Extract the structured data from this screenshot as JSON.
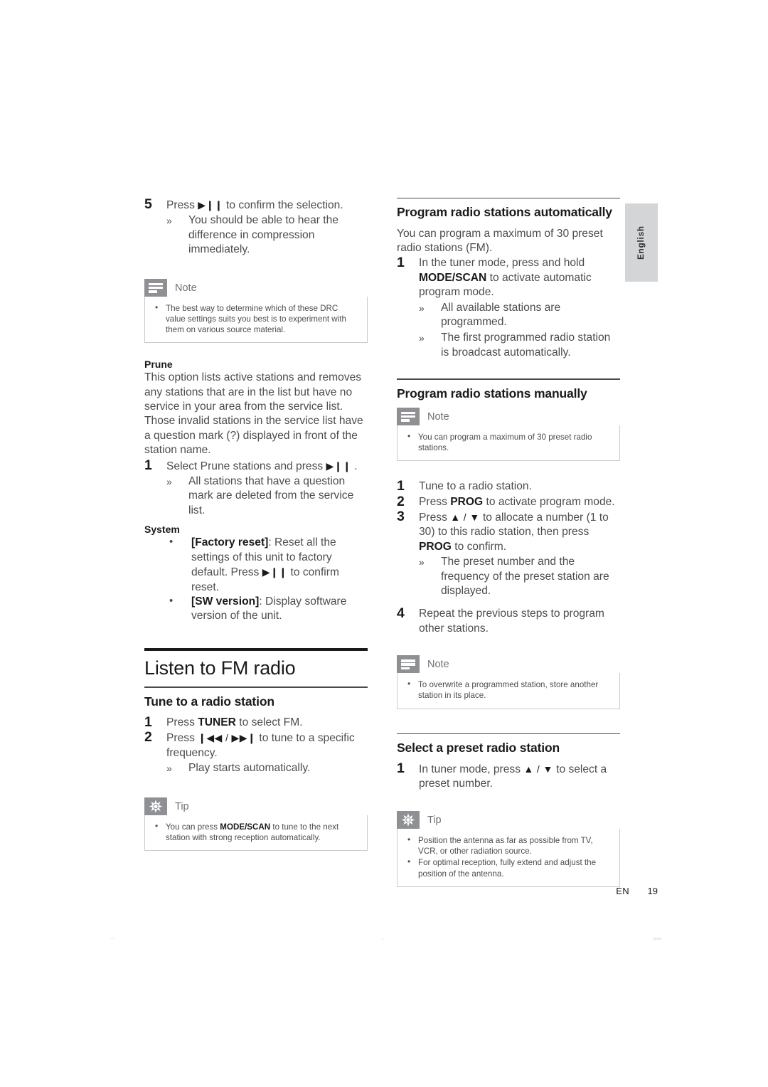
{
  "page": {
    "language_tab": "English",
    "footer_language_code": "EN",
    "footer_page_number": "19"
  },
  "left_column": {
    "step5": {
      "number": "5",
      "text_before": "Press",
      "glyph": "▶❙❙",
      "text_after": "to confirm the selection.",
      "result": "You should be able to hear the difference in compression immediately."
    },
    "note_drc": {
      "label": "Note",
      "icon": "note-icon",
      "items": [
        "The best way to determine which of these DRC value settings suits you best is to experiment with them on various source material."
      ]
    },
    "prune": {
      "heading": "Prune",
      "paragraph": "This option lists active stations and removes any stations that are in the list but have no service in your area from the service list. Those invalid stations in the service list have a question mark (?) displayed in front of the station name.",
      "step1": {
        "number": "1",
        "text_before": "Select Prune stations and press",
        "glyph": "▶❙❙",
        "text_after": ".",
        "result": "All stations that have a question mark are deleted from the service list."
      }
    },
    "system": {
      "heading": "System",
      "items": [
        {
          "term": "[Factory reset]",
          "text_before": ": Reset all the settings of this unit to factory default. Press",
          "glyph": "▶❙❙",
          "text_after": "to confirm reset."
        },
        {
          "term": "[SW version]",
          "text_before": ": Display software version of the unit.",
          "glyph": "",
          "text_after": ""
        }
      ]
    },
    "listen_fm": {
      "title": "Listen to FM radio",
      "tune": {
        "heading": "Tune to a radio station",
        "step1": {
          "number": "1",
          "text_before": "Press",
          "kbd": "TUNER",
          "text_after": "to select FM."
        },
        "step2": {
          "number": "2",
          "text_before": "Press",
          "glyph": "❙◀◀ / ▶▶❙",
          "text_after": "to tune to a specific frequency.",
          "result": "Play starts automatically."
        }
      },
      "tip": {
        "label": "Tip",
        "icon": "tip-icon",
        "items": [
          {
            "before": "You can press ",
            "kbd": "MODE/SCAN",
            "after": " to tune to the next station with strong reception automatically."
          }
        ]
      }
    }
  },
  "right_column": {
    "program_auto": {
      "heading": "Program radio stations automatically",
      "paragraph": "You can program a maximum of 30 preset radio stations (FM).",
      "step1": {
        "number": "1",
        "text_before": "In the tuner mode, press and hold",
        "kbd": "MODE/SCAN",
        "text_after": "to activate automatic program mode.",
        "results": [
          "All available stations are programmed.",
          "The first programmed radio station is broadcast automatically."
        ]
      }
    },
    "program_manual": {
      "heading": "Program radio stations manually",
      "note": {
        "label": "Note",
        "icon": "note-icon",
        "items": [
          "You can program a maximum of 30 preset radio stations."
        ]
      },
      "steps": [
        {
          "number": "1",
          "text": "Tune to a radio station."
        },
        {
          "number": "2",
          "text_before": "Press",
          "kbd": "PROG",
          "text_after": "to activate program mode."
        },
        {
          "number": "3",
          "text_before": "Press",
          "glyph": "▲ / ▼",
          "text_mid": "to allocate a number (1 to 30) to this radio station, then press",
          "kbd": "PROG",
          "text_after": "to confirm.",
          "result": "The preset number and the frequency of the preset station are displayed."
        },
        {
          "number": "4",
          "text": "Repeat the previous steps to program other stations."
        }
      ],
      "note2": {
        "label": "Note",
        "icon": "note-icon",
        "items": [
          "To overwrite a programmed station, store another station in its place."
        ]
      }
    },
    "select_preset": {
      "heading": "Select a preset radio station",
      "step1": {
        "number": "1",
        "text_before": "In tuner mode, press",
        "glyph": "▲ / ▼",
        "text_after": "to select a preset number."
      },
      "tip": {
        "label": "Tip",
        "icon": "tip-icon",
        "items": [
          "Position the antenna as far as possible from TV, VCR, or other radiation source.",
          "For optimal reception, fully extend and adjust the position of the antenna."
        ]
      }
    }
  }
}
